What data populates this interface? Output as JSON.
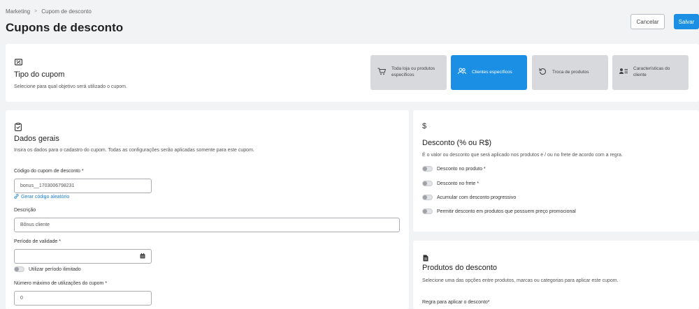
{
  "breadcrumb": {
    "root": "Marketing",
    "separator": ">",
    "current": "Cupom de desconto"
  },
  "page": {
    "title": "Cupons de desconto"
  },
  "actions": {
    "cancel_label": "Cancelar",
    "save_label": "Salvar"
  },
  "coupon_type": {
    "title": "Tipo do cupom",
    "subtitle": "Selecione para qual objetivo será utilizado o cupom.",
    "options": [
      {
        "label": "Toda loja ou produtos específicos",
        "icon": "cart-icon",
        "active": false
      },
      {
        "label": "Clientes específicos",
        "icon": "users-icon",
        "active": true
      },
      {
        "label": "Troca de produtos",
        "icon": "rotate-icon",
        "active": false
      },
      {
        "label": "Características do cliente",
        "icon": "user-list-icon",
        "active": false
      }
    ]
  },
  "general": {
    "title": "Dados gerais",
    "subtitle": "Insira os dados para o cadastro do cupom. Todas as configurações serão aplicadas somente para este cupom.",
    "code_label": "Código do cupom de desconto *",
    "code_value": "bonus__1703006798231",
    "random_code_link": "Gerar código aleatório",
    "description_label": "Descrição",
    "description_value": "Bônus cliente",
    "validity_label": "Período de validade *",
    "validity_value": "",
    "unlimited_label": "Utilizar período ilimitado",
    "max_uses_label": "Número máximo de utilizações do cupom *",
    "max_uses_value": "0"
  },
  "discount": {
    "title": "Desconto (% ou R$)",
    "subtitle": "É o valor ou desconto que será aplicado nos produtos e / ou no frete de acordo com a regra.",
    "toggles": [
      "Desconto no produto *",
      "Desconto no frete *",
      "Acumular com desconto progressivo",
      "Permitir desconto em produtos que possuem preço promocional"
    ]
  },
  "products": {
    "title": "Produtos do desconto",
    "subtitle": "Selecione uma das opções entre produtos, marcas ou categorias para aplicar este cupom.",
    "rule_label": "Regra para aplicar o desconto*"
  },
  "colors": {
    "accent": "#1a8fe3",
    "background": "#f2f3f5",
    "option_inactive": "#d7d9dc"
  }
}
